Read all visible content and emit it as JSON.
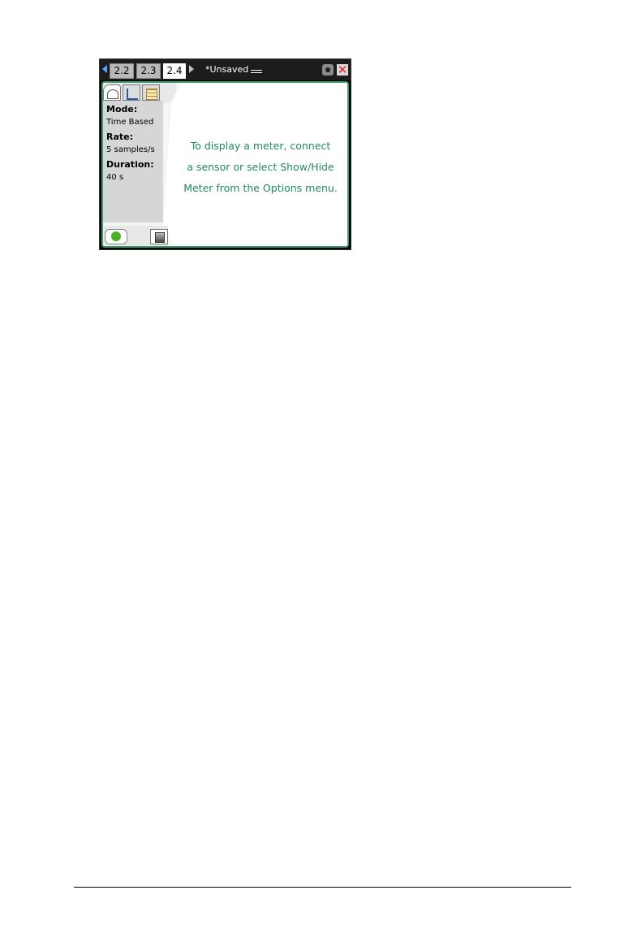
{
  "header": {
    "tabs": [
      {
        "label": "2.2"
      },
      {
        "label": "2.3"
      },
      {
        "label": "2.4"
      }
    ],
    "doc_title": "*Unsaved"
  },
  "side_panel": {
    "mode_label": "Mode:",
    "mode_value": "Time Based",
    "rate_label": "Rate:",
    "rate_value": "5 samples/s",
    "duration_label": "Duration:",
    "duration_value": "40 s"
  },
  "main": {
    "message_lines": [
      "To display a meter, connect",
      "a sensor or select Show/Hide",
      "Meter from the Options menu."
    ]
  },
  "colors": {
    "accent": "#3d9a6b",
    "message_text": "#1f8a5e",
    "start_icon": "#4caf2b"
  },
  "icons": {
    "nav_left": "left-arrow-icon",
    "nav_right": "right-arrow-icon",
    "doc_menu": "menu-icon",
    "settings": "gear-icon",
    "close": "close-icon",
    "meter_view": "meter-icon",
    "graph_view": "graph-icon",
    "table_view": "table-icon",
    "start": "play-icon",
    "collection": "collection-mode-icon"
  }
}
